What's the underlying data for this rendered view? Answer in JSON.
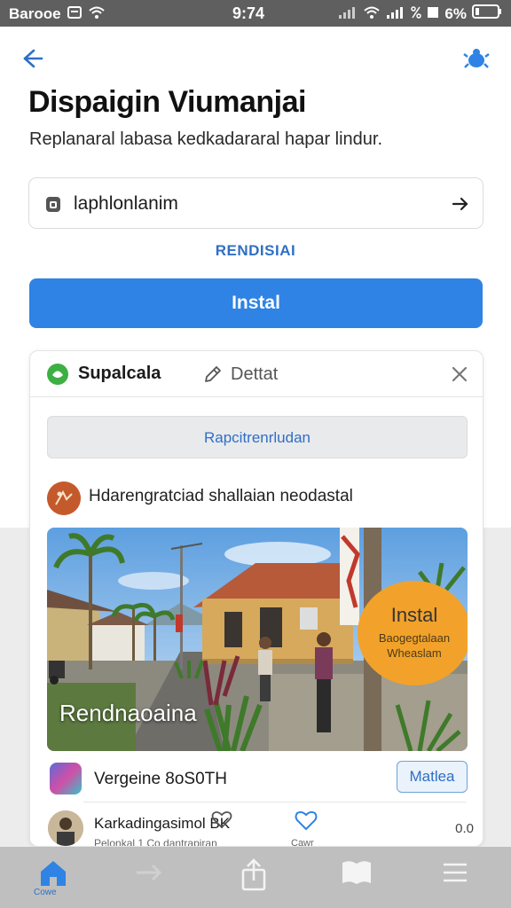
{
  "status_bar": {
    "carrier": "Barooe",
    "time": "9:74",
    "battery": "6%"
  },
  "header": {
    "title": "Dispaigin Viumanjai",
    "subtitle": "Replanaral labasa kedkadararal hapar lindur."
  },
  "field": {
    "value": "laphlonlanim"
  },
  "link_text": "RENDISIAI",
  "install_button": "Instal",
  "card": {
    "name": "Supalcala",
    "edit_label": "Dettat",
    "gray_button": "Rapcitrenrludan",
    "post_title": "Hdarengratciad shallaian neodastal",
    "photo_caption": "Rendnaoaina",
    "bubble_title": "Instal",
    "bubble_text": "Baogegtalaan Wheaslam",
    "row1_text": "Vergeine 8oS0TH",
    "row1_button": "Matlea",
    "row2_title": "Karkadingasimol BK",
    "row2_sub": "Pelonkal 1 Co dantrapiran",
    "heart_label": "Cawr",
    "row2_count": "0.0"
  },
  "toolbar": {
    "home_label": "Cowe",
    "items": [
      "home-icon",
      "forward-icon",
      "share-icon",
      "book-icon",
      "menu-icon"
    ]
  },
  "colors": {
    "accent": "#2f83e4",
    "link": "#2f6fc4",
    "bubble": "#f2a22a"
  }
}
